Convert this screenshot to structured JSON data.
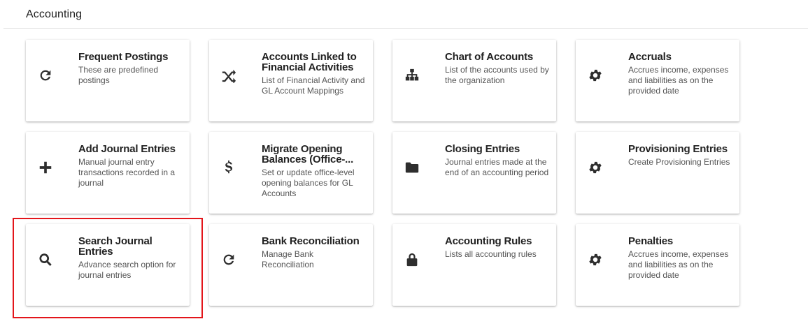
{
  "section": {
    "title": "Accounting"
  },
  "highlight": {
    "color": "#e3161b"
  },
  "cards": [
    {
      "title": "Frequent Postings",
      "desc": "These are predefined postings",
      "icon": "refresh-icon"
    },
    {
      "title": "Accounts Linked to Financial Activities",
      "desc": "List of Financial Activity and GL Account Mappings",
      "icon": "shuffle-icon"
    },
    {
      "title": "Chart of Accounts",
      "desc": "List of the accounts used by the organization",
      "icon": "sitemap-icon"
    },
    {
      "title": "Accruals",
      "desc": "Accrues income, expenses and liabilities as on the provided date",
      "icon": "gear-icon"
    },
    {
      "title": "Add Journal Entries",
      "desc": "Manual journal entry transactions recorded in a journal",
      "icon": "plus-icon"
    },
    {
      "title": "Migrate Opening Balances (Office-...",
      "desc": "Set or update office-level opening balances for GL Accounts",
      "icon": "dollar-icon"
    },
    {
      "title": "Closing Entries",
      "desc": "Journal entries made at the end of an accounting period",
      "icon": "folder-icon"
    },
    {
      "title": "Provisioning Entries",
      "desc": "Create Provisioning Entries",
      "icon": "gear-icon"
    },
    {
      "title": "Search Journal Entries",
      "desc": "Advance search option for journal entries",
      "icon": "search-icon"
    },
    {
      "title": "Bank Reconciliation",
      "desc": "Manage Bank Reconciliation",
      "icon": "refresh-icon"
    },
    {
      "title": "Accounting Rules",
      "desc": "Lists all accounting rules",
      "icon": "lock-icon"
    },
    {
      "title": "Penalties",
      "desc": "Accrues income, expenses and liabilities as on the provided date",
      "icon": "gear-icon"
    }
  ]
}
